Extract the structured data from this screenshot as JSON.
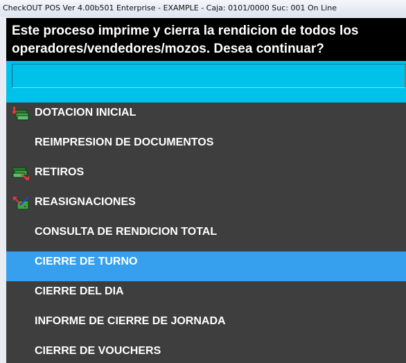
{
  "window": {
    "title": "CheckOUT POS Ver 4.00b501 Enterprise - EXAMPLE - Caja: 0101/0000 Suc: 001  On Line"
  },
  "prompt": {
    "line1": "Este proceso imprime y cierra la rendicion de todos los",
    "line2": "operadores/vendedores/mozos. Desea continuar?"
  },
  "input": {
    "value": ""
  },
  "menu": {
    "selected_index": 5,
    "items": [
      {
        "label": "DOTACION INICIAL",
        "icon": "cash-add-icon"
      },
      {
        "label": "REIMPRESION DE DOCUMENTOS",
        "icon": ""
      },
      {
        "label": "RETIROS",
        "icon": "cash-withdraw-icon"
      },
      {
        "label": "REASIGNACIONES",
        "icon": "cash-reassign-icon"
      },
      {
        "label": "CONSULTA DE RENDICION TOTAL",
        "icon": ""
      },
      {
        "label": "CIERRE DE TURNO",
        "icon": ""
      },
      {
        "label": "CIERRE DEL DIA",
        "icon": ""
      },
      {
        "label": "INFORME DE CIERRE DE JORNADA",
        "icon": ""
      },
      {
        "label": "CIERRE DE VOUCHERS",
        "icon": ""
      }
    ]
  },
  "colors": {
    "prompt_bg": "#000000",
    "input_band": "#00c1ea",
    "menu_bg": "#3e3e3e",
    "selected": "#36a0ef"
  }
}
